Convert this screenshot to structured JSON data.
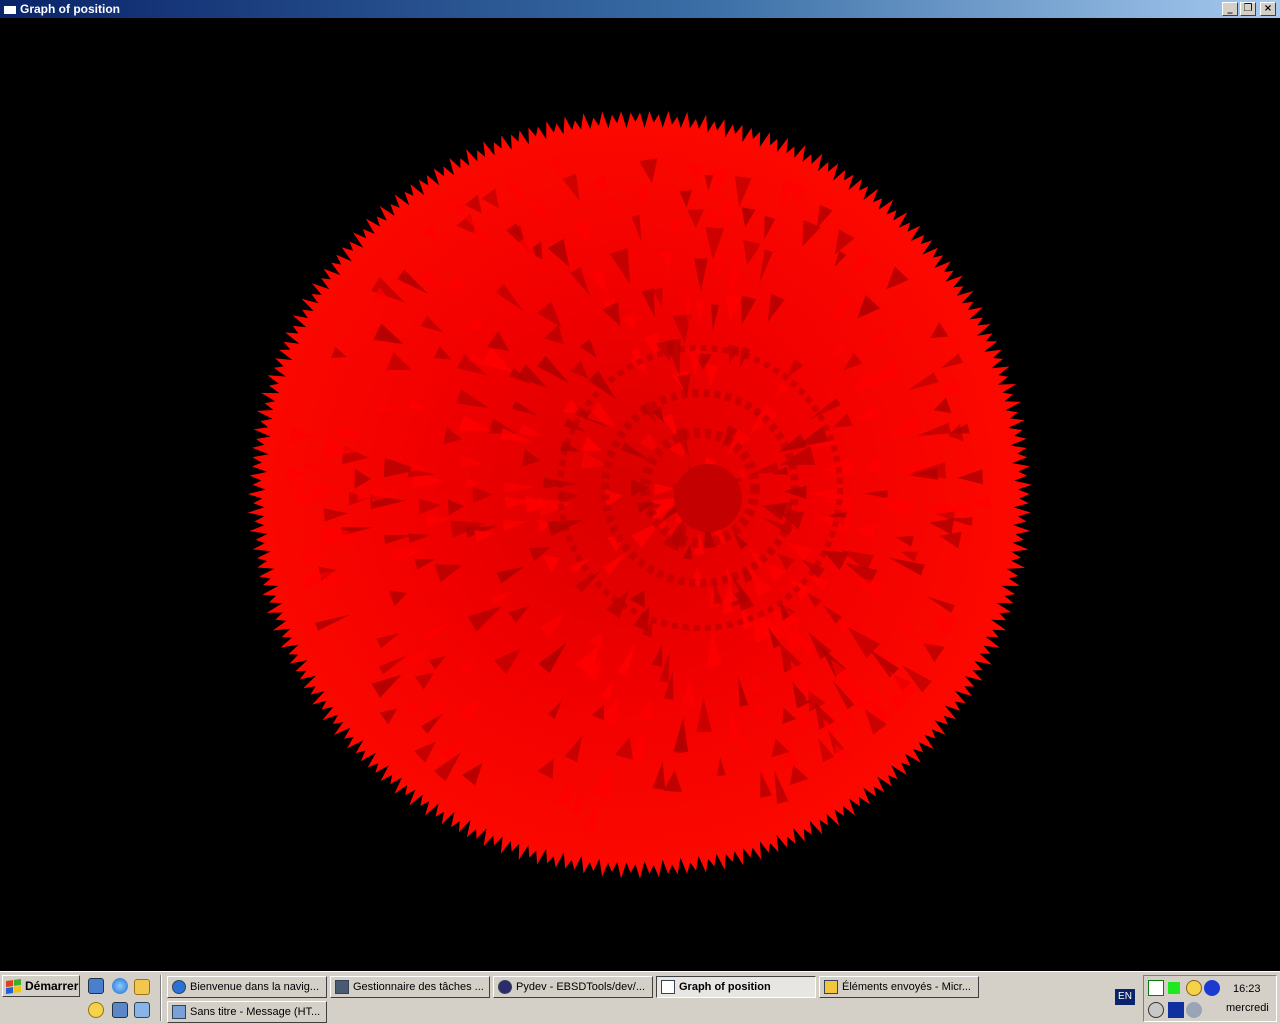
{
  "window": {
    "title": "Graph of position",
    "buttons": {
      "minimize": "_",
      "restore": "❐",
      "close": "×"
    }
  },
  "viewport": {
    "background": "#000000",
    "object_color": "#ff0000",
    "object_shadow": "#b00000"
  },
  "taskbar": {
    "start_label": "Démarrer",
    "quicklaunch": [
      {
        "icon": "show-desktop-icon"
      },
      {
        "icon": "internet-explorer-icon"
      },
      {
        "icon": "explorer-folder-icon"
      },
      {
        "icon": "clock-app-icon"
      },
      {
        "icon": "network-icon"
      },
      {
        "icon": "document-icon"
      }
    ],
    "tasks": [
      {
        "label": "Bienvenue dans la navig...",
        "icon": "ie-icon",
        "active": false
      },
      {
        "label": "Gestionnaire des tâches ...",
        "icon": "task-manager-icon",
        "active": false
      },
      {
        "label": "Pydev - EBSDTools/dev/...",
        "icon": "eclipse-icon",
        "active": false
      },
      {
        "label": "Graph of position",
        "icon": "window-icon",
        "active": true
      },
      {
        "label": "Éléments envoyés - Micr...",
        "icon": "outlook-icon",
        "active": false
      },
      {
        "label": "Sans titre - Message (HT...",
        "icon": "message-icon",
        "active": false
      }
    ],
    "language": "EN",
    "time": "16:23",
    "day": "mercredi",
    "tray_icons": [
      "vnc-icon",
      "status-green-icon",
      "clock-icon",
      "audio-icon",
      "media-player-icon",
      "save-icon",
      "network-status-icon"
    ]
  }
}
